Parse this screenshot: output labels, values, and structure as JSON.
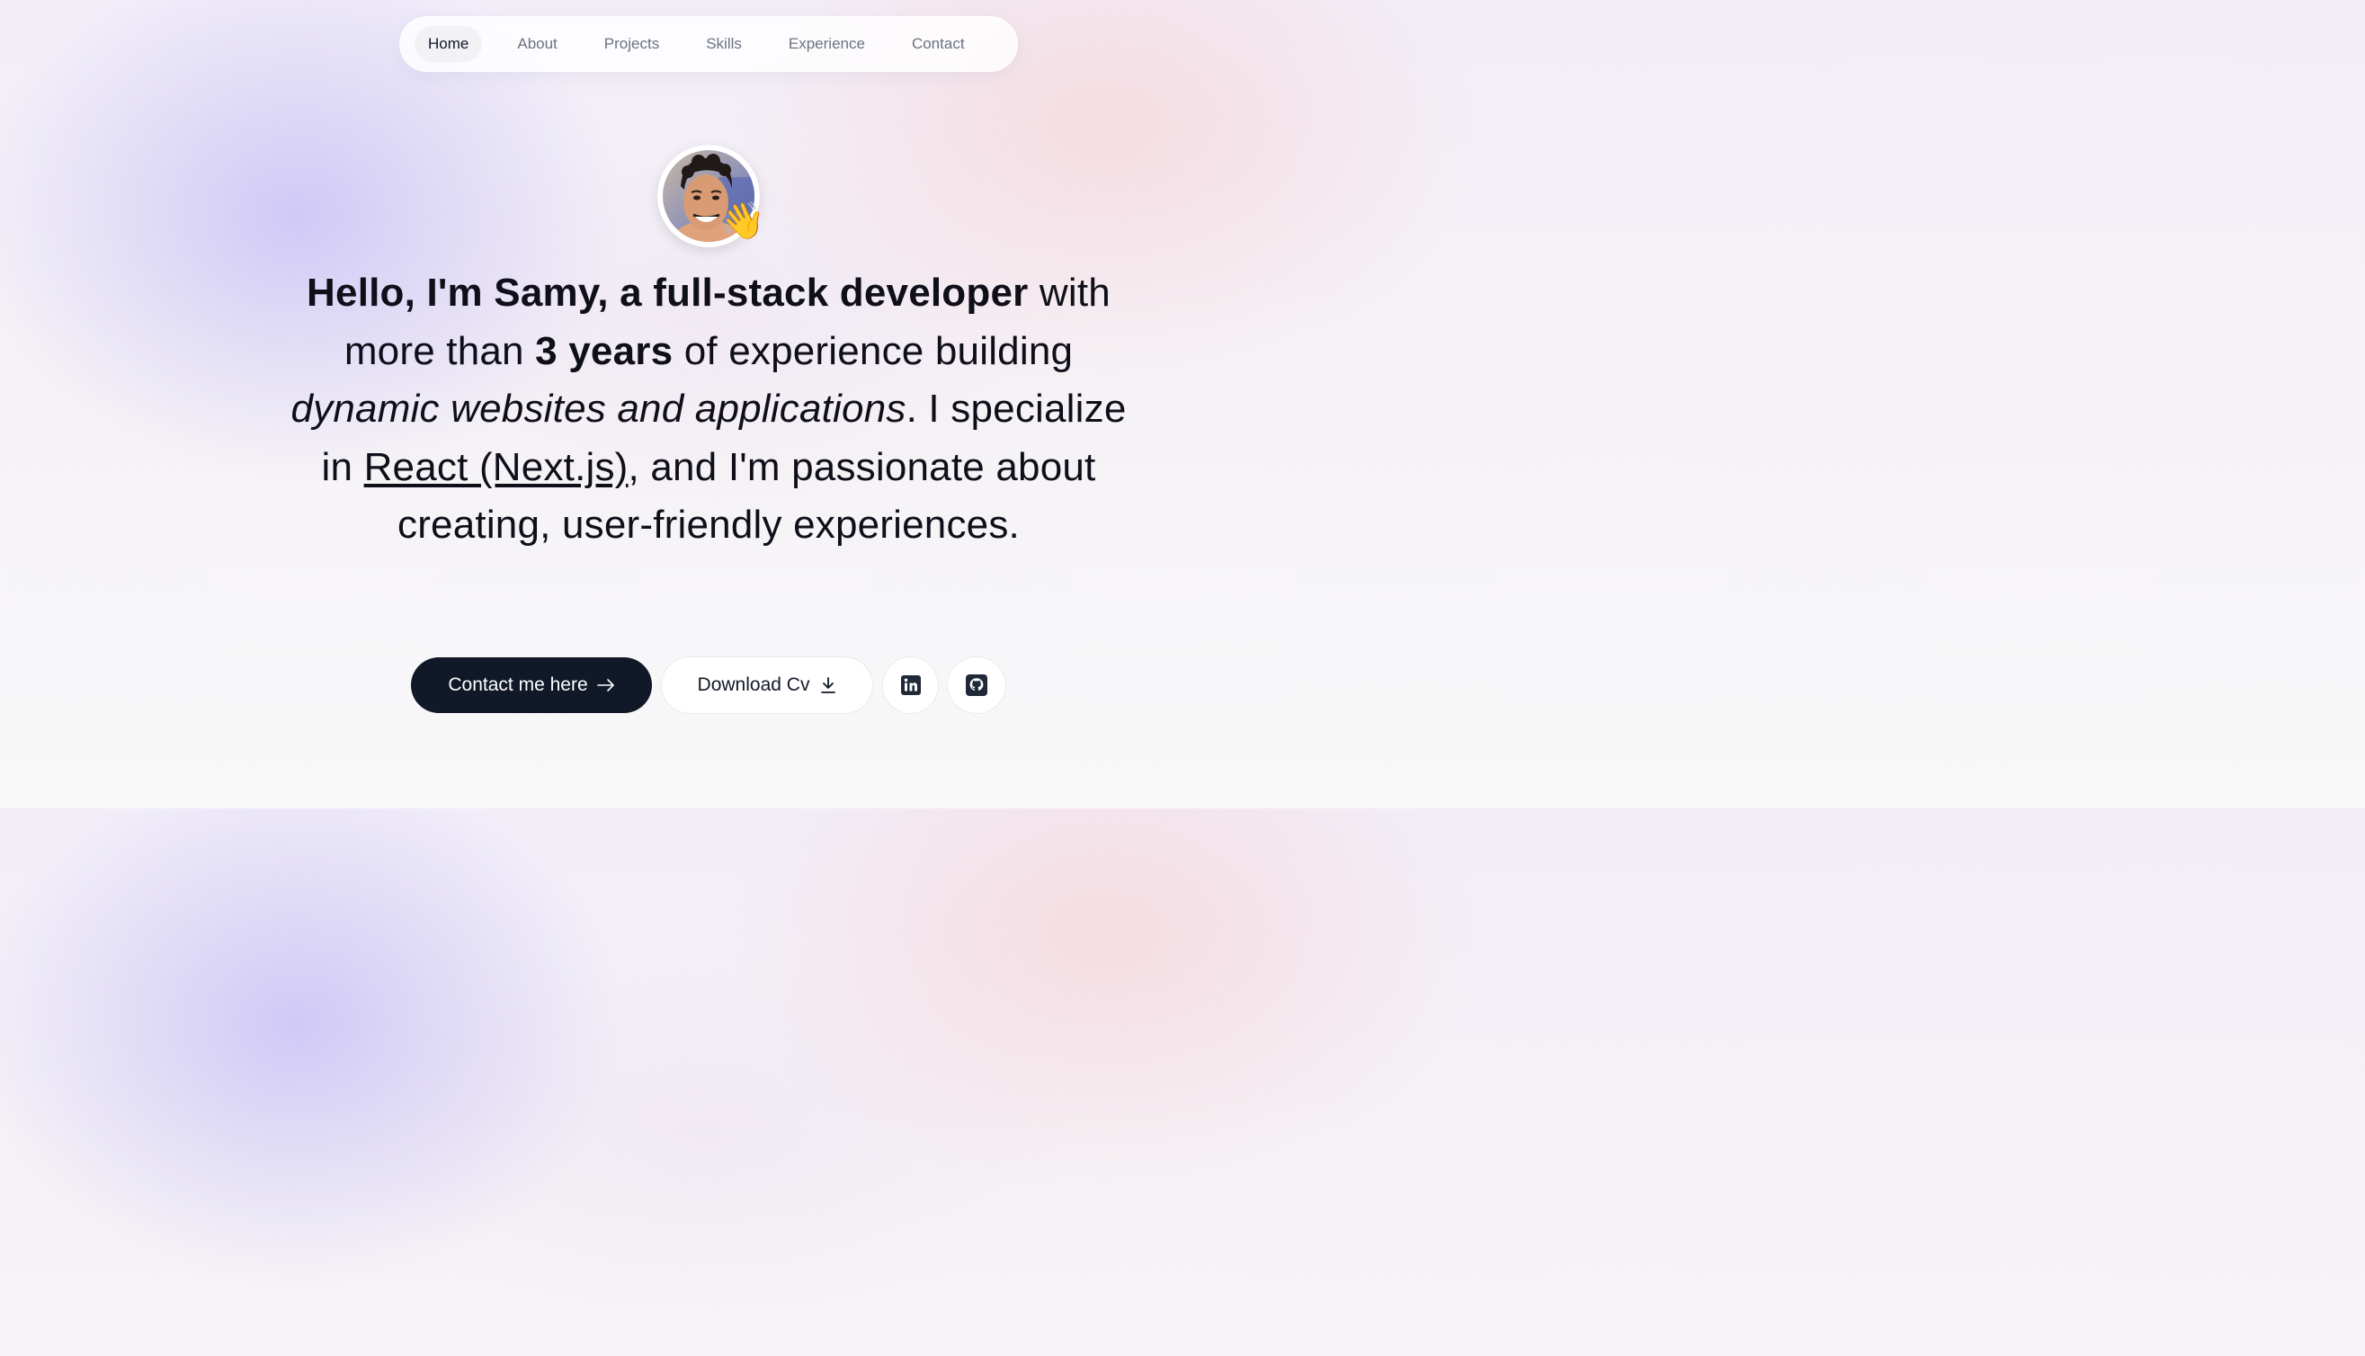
{
  "nav": {
    "items": [
      {
        "label": "Home",
        "active": true
      },
      {
        "label": "About",
        "active": false
      },
      {
        "label": "Projects",
        "active": false
      },
      {
        "label": "Skills",
        "active": false
      },
      {
        "label": "Experience",
        "active": false
      },
      {
        "label": "Contact",
        "active": false
      }
    ]
  },
  "hero": {
    "avatar_emoji": "👋",
    "headline": {
      "bold_intro": "Hello, I'm Samy, a full-stack developer",
      "t1": " with more than ",
      "bold_years": "3 years",
      "t2": " of experience building ",
      "italic_phrase": "dynamic websites and applications",
      "t3": ". I specialize in ",
      "underline_tech": "React (Next.js)",
      "t4": ", and I'm passionate about creating, user-friendly experiences."
    }
  },
  "actions": {
    "contact_label": "Contact me here",
    "contact_icon": "arrow-right-icon",
    "download_label": "Download Cv",
    "download_icon": "download-icon",
    "linkedin_icon": "linkedin-icon",
    "github_icon": "github-icon"
  },
  "colors": {
    "primary_button": "#111827",
    "text": "#0f0f1a",
    "nav_inactive": "#6b7280"
  }
}
